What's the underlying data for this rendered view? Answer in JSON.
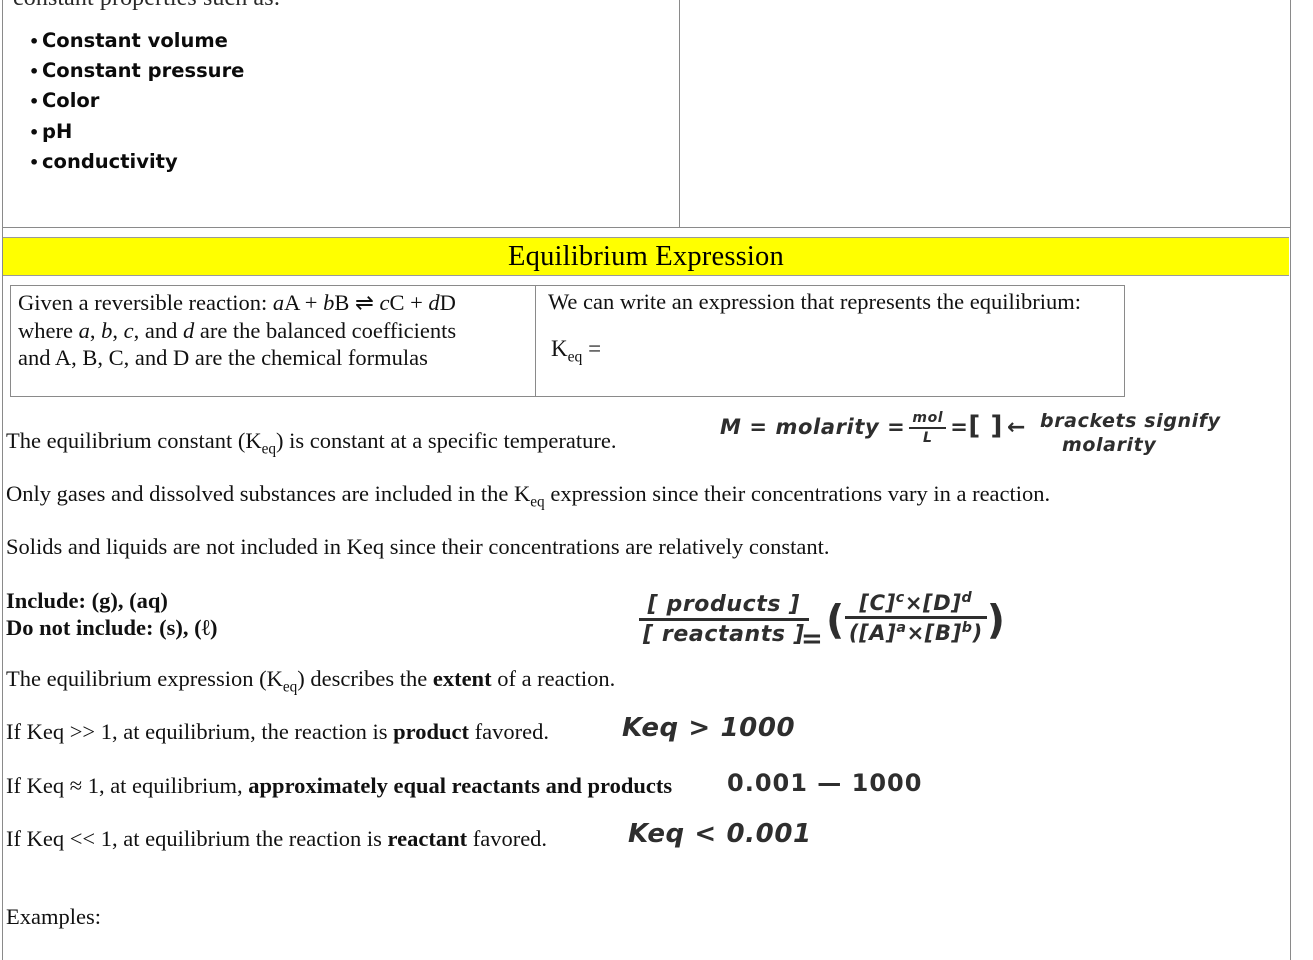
{
  "document": {
    "clipped_top_line": "constant properties such as:",
    "bullets": [
      "Constant volume",
      "Constant pressure",
      "Color",
      "pH",
      "conductivity"
    ],
    "banner": {
      "title": "Equilibrium Expression",
      "background_color": "#FFFF00"
    },
    "keq_table": {
      "left_cell": {
        "line1_pre": "Given a reversible reaction:  ",
        "line1_eq_a": "a",
        "line1_eq_A": "A + ",
        "line1_eq_b": "b",
        "line1_eq_B": "B ⇌ ",
        "line1_eq_c": "c",
        "line1_eq_C": "C + ",
        "line1_eq_d": "d",
        "line1_eq_D": "D",
        "line2_pre": "where ",
        "line2_a": "a",
        "line2_s1": ", ",
        "line2_b": "b",
        "line2_s2": ", ",
        "line2_c": "c",
        "line2_s3": ", and ",
        "line2_d": "d",
        "line2_post": " are the balanced coefficients",
        "line3": "and A, B, C, and D are the chemical formulas"
      },
      "right_cell": {
        "heading": "We can write an expression that represents the equilibrium:",
        "keq_label": "K",
        "keq_label_sub": "eq",
        "keq_label_eq": " =",
        "handwritten": {
          "numerator": "[ products ]",
          "denominator": "[ reactants ]",
          "equals": "=",
          "rhs_numerator": "[C]",
          "rhs_numerator_exp1": "c",
          "rhs_numerator_times": "×[D]",
          "rhs_numerator_exp2": "d",
          "rhs_denominator": "([A]",
          "rhs_denominator_exp1": "a",
          "rhs_denominator_times": "×[B]",
          "rhs_denominator_exp2": "b",
          "rhs_denominator_close": ")"
        }
      }
    },
    "annotations": {
      "molarity": {
        "m": "M = molarity =",
        "frac_num": "mol",
        "frac_den": "L",
        "equals": "=",
        "brackets": "[  ]",
        "arrow": "←",
        "note_line1": "brackets signify",
        "note_line2": "molarity"
      },
      "keq_large": "Keq  >  1000",
      "keq_medium": "0.001  —  1000",
      "keq_small": "Keq  <  0.001"
    },
    "paragraphs": {
      "p1_a": "The equilibrium constant (K",
      "p1_sub": "eq",
      "p1_b": ") is constant at a specific temperature.",
      "p2_a": "Only gases and dissolved substances are included in the K",
      "p2_sub": "eq",
      "p2_b": " expression since their concentrations vary in a reaction.",
      "p3": "Solids and liquids are not included in Keq since their concentrations are relatively constant.",
      "p4_line1": "Include: (g), (aq)",
      "p4_line2": "Do not include: (s), (ℓ)",
      "p5_a": "The equilibrium expression (K",
      "p5_sub": "eq",
      "p5_b": ") describes the ",
      "p5_bold": "extent",
      "p5_c": " of a reaction.",
      "p6_a": "If Keq >> 1, at equilibrium, the reaction is ",
      "p6_bold": "product",
      "p6_b": " favored.",
      "p7_a": "If Keq ≈ 1, at equilibrium, ",
      "p7_bold": "approximately equal reactants and products",
      "p8_a": "If Keq << 1, at equilibrium the reaction is ",
      "p8_bold": "reactant",
      "p8_b": " favored.",
      "p9": "Examples:"
    }
  }
}
